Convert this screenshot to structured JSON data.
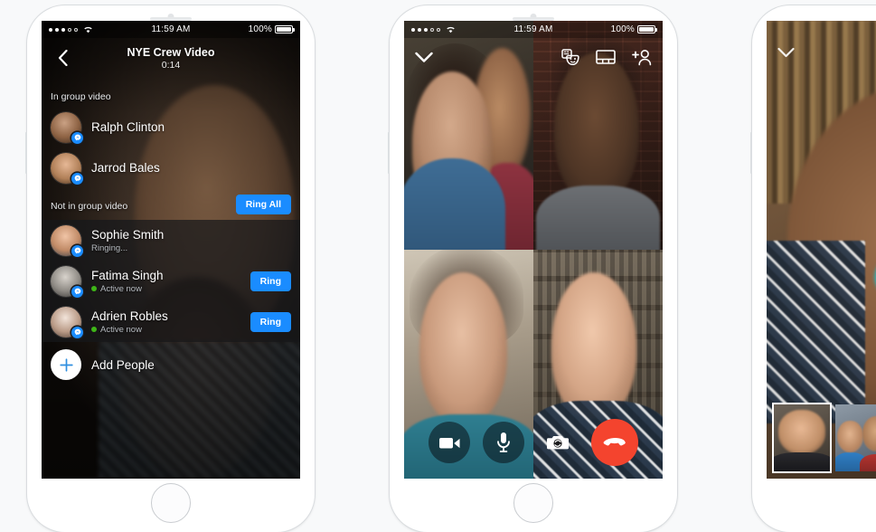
{
  "status_bar": {
    "time": "11:59 AM",
    "battery_percent": "100%",
    "signal_dots_filled": 3,
    "signal_dots_empty": 2,
    "wifi_icon": "wifi-icon",
    "battery_icon": "battery-icon"
  },
  "phone1": {
    "header": {
      "back_icon": "back-chevron-icon",
      "title": "NYE Crew Video",
      "duration": "0:14"
    },
    "sections": {
      "in_group": "In group video",
      "not_in_group": "Not in group video"
    },
    "ring_all_label": "Ring All",
    "in_group_participants": [
      {
        "name": "Ralph Clinton",
        "badge": "messenger-badge-icon"
      },
      {
        "name": "Jarrod Bales",
        "badge": "messenger-badge-icon"
      }
    ],
    "not_in_group_participants": [
      {
        "name": "Sophie Smith",
        "status": "Ringing...",
        "has_green_dot": false,
        "action": ""
      },
      {
        "name": "Fatima Singh",
        "status": "Active now",
        "has_green_dot": true,
        "action": "Ring"
      },
      {
        "name": "Adrien Robles",
        "status": "Active now",
        "has_green_dot": true,
        "action": "Ring"
      }
    ],
    "add_people": {
      "label": "Add People",
      "icon": "plus-circle-icon"
    }
  },
  "phone2": {
    "top_bar": {
      "minimize_icon": "chevron-down-icon",
      "effects_icon": "masks-effects-icon",
      "layout_icon": "grid-layout-icon",
      "add_person_icon": "add-person-icon"
    },
    "grid_tiles": [
      {
        "position": "top-left",
        "label": "participant-video-1"
      },
      {
        "position": "top-right",
        "label": "participant-video-2"
      },
      {
        "position": "bottom-left",
        "label": "participant-video-3"
      },
      {
        "position": "bottom-right",
        "label": "participant-video-4"
      }
    ],
    "controls": [
      {
        "icon": "video-camera-icon",
        "style": "dark"
      },
      {
        "icon": "microphone-icon",
        "style": "dark"
      },
      {
        "icon": "camera-flip-icon",
        "style": "plain"
      },
      {
        "icon": "end-call-icon",
        "style": "hangup"
      }
    ]
  },
  "phone3": {
    "minimize_icon": "chevron-down-icon",
    "thumbnails": [
      {
        "label": "thumbnail-participant-1",
        "selected": true
      },
      {
        "label": "thumbnail-participant-2",
        "selected": false
      }
    ]
  },
  "colors": {
    "accent_blue": "#1a8cff",
    "hangup_red": "#f4442e",
    "active_green": "#3fb618",
    "page_background": "#f8f9fa"
  }
}
